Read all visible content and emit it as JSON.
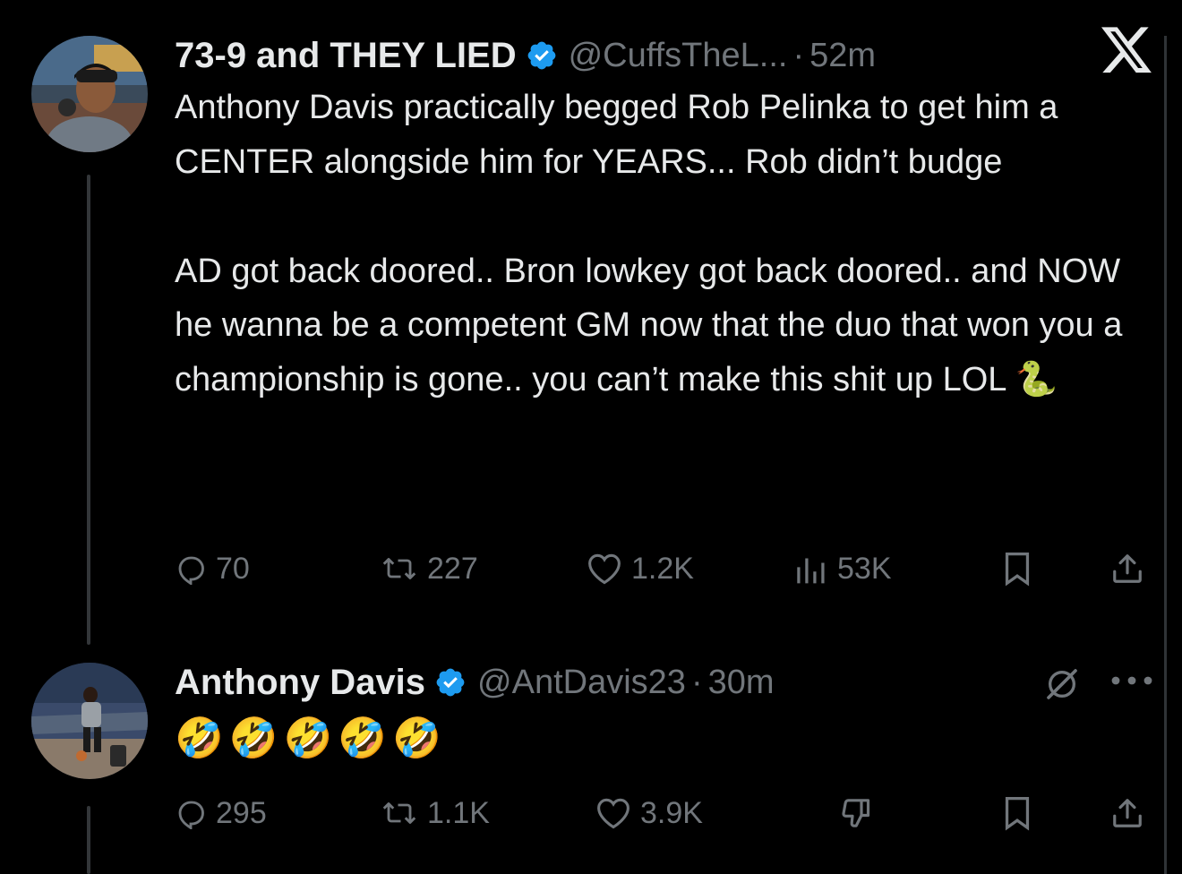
{
  "colors": {
    "background": "#000000",
    "text": "#e7e9ea",
    "muted": "#71767b",
    "verified": "#1d9bf0",
    "thread_line": "#333639"
  },
  "tweets": [
    {
      "author_name": "73-9 and THEY LIED",
      "handle": "@CuffsTheL...",
      "separator": "·",
      "time": "52m",
      "verified": true,
      "paragraphs": [
        "Anthony Davis practically begged Rob Pelinka to get him a CENTER alongside him for YEARS... Rob didn’t budge",
        "AD got back doored.. Bron lowkey got back doored.. and NOW he wanna be a competent GM now that the duo that won you a championship is gone.. you can’t make this shit up LOL 🐍"
      ],
      "actions": {
        "replies": "70",
        "reposts": "227",
        "likes": "1.2K",
        "views": "53K"
      },
      "icons": [
        "reply-icon",
        "repost-icon",
        "like-icon",
        "views-icon",
        "bookmark-icon",
        "share-icon",
        "x-logo"
      ]
    },
    {
      "author_name": "Anthony Davis",
      "handle": "@AntDavis23",
      "separator": "·",
      "time": "30m",
      "verified": true,
      "text": "🤣🤣🤣🤣🤣",
      "actions": {
        "replies": "295",
        "reposts": "1.1K",
        "likes": "3.9K"
      },
      "icons": [
        "reply-icon",
        "repost-icon",
        "like-icon",
        "dislike-icon",
        "bookmark-icon",
        "share-icon",
        "grok-icon",
        "more-icon"
      ]
    }
  ]
}
